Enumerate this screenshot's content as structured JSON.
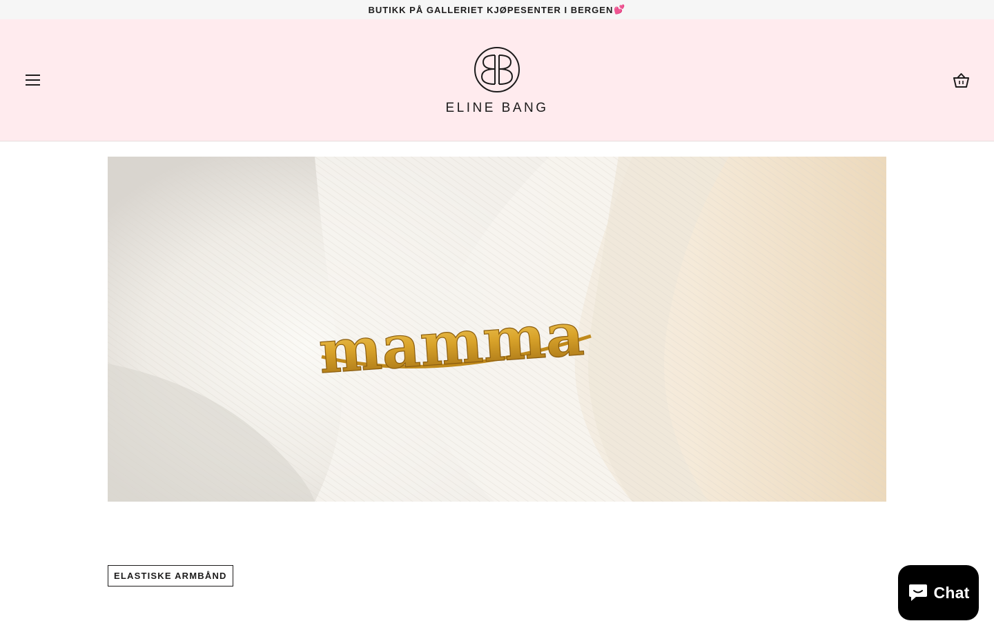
{
  "announcement": {
    "text": "BUTIKK PÅ GALLERIET KJØPESENTER I BERGEN",
    "emoji": "💕"
  },
  "header": {
    "menu_icon": "hamburger-menu-icon",
    "logo_text": "ELINE BANG",
    "cart_icon": "shopping-basket-icon",
    "background": "#ffebee"
  },
  "hero": {
    "image_alt": "Gold ring reading mamma on white fabric",
    "ring_text": "mamma"
  },
  "collection_tag": "ELASTISKE ARMBÅND",
  "chat": {
    "label": "Chat",
    "icon": "chat-bubble-icon"
  }
}
